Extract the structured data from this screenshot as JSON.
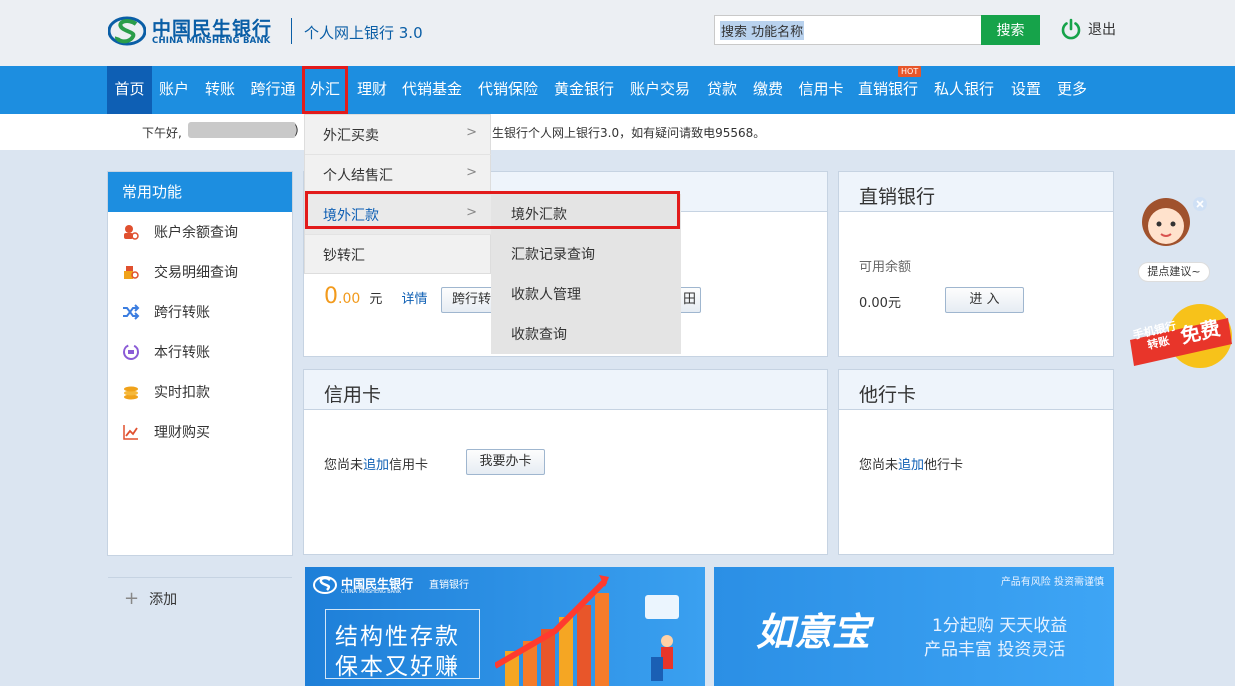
{
  "header": {
    "bank_name_cn": "中国民生银行",
    "bank_name_en": "CHINA MINSHENG BANK",
    "product": "个人网上银行 3.0",
    "search_value": "搜索 功能名称",
    "search_button": "搜索",
    "logout": "退出"
  },
  "nav": {
    "items": [
      "首页",
      "账户",
      "转账",
      "跨行通",
      "外汇",
      "理财",
      "代销基金",
      "代销保险",
      "黄金银行",
      "账户交易",
      "贷款",
      "缴费",
      "信用卡",
      "直销银行",
      "私人银行",
      "设置",
      "更多"
    ],
    "hot_badge": "HOT"
  },
  "welcome": {
    "greeting": "下午好,",
    "paren_open": "(",
    "paren_close": ")",
    "message": "生银行个人网上银行3.0，如有疑问请致电95568。"
  },
  "sidebar": {
    "title": "常用功能",
    "items": [
      "账户余额查询",
      "交易明细查询",
      "跨行转账",
      "本行转账",
      "实时扣款",
      "理财购买"
    ],
    "add": "添加"
  },
  "account_panel": {
    "balance_int": "0",
    "balance_dec": ".00",
    "unit": "元",
    "detail_link": "详情",
    "cross_transfer_btn": "跨行转",
    "hidden_btn_tail": "田"
  },
  "direct_bank": {
    "title": "直销银行",
    "available_label": "可用余额",
    "available_value": "0.00元",
    "enter_button": "进 入"
  },
  "credit_card": {
    "title": "信用卡",
    "text_before": "您尚未",
    "add_link": "追加",
    "text_after": "信用卡",
    "apply_button": "我要办卡"
  },
  "other_bank": {
    "title": "他行卡",
    "text_before": "您尚未",
    "add_link": "追加",
    "text_after": "他行卡"
  },
  "fx_menu": {
    "items": [
      "外汇买卖",
      "个人结售汇",
      "境外汇款",
      "钞转汇"
    ],
    "submenu": [
      "境外汇款",
      "汇款记录查询",
      "收款人管理",
      "收款查询"
    ]
  },
  "floating": {
    "suggestion": "提点建议~",
    "promo_line1": "手机银行",
    "promo_line2": "转账",
    "promo_free": "免费"
  },
  "banners": {
    "left_logo": "中国民生银行",
    "left_logo_en": "CHINA MINSHENG BANK",
    "left_tag": "直销银行",
    "left_line1": "结构性存款",
    "left_line2": "保本又好赚",
    "right_risk": "产品有风险 投资需谨慎",
    "right_brand": "如意宝",
    "right_line1": "1分起购 天天收益",
    "right_line2": "产品丰富 投资灵活"
  },
  "colors": {
    "nav_blue": "#1d8ee0",
    "brand_blue": "#0a5ea6",
    "search_green": "#16a34a",
    "highlight_red": "#e21b1b"
  }
}
